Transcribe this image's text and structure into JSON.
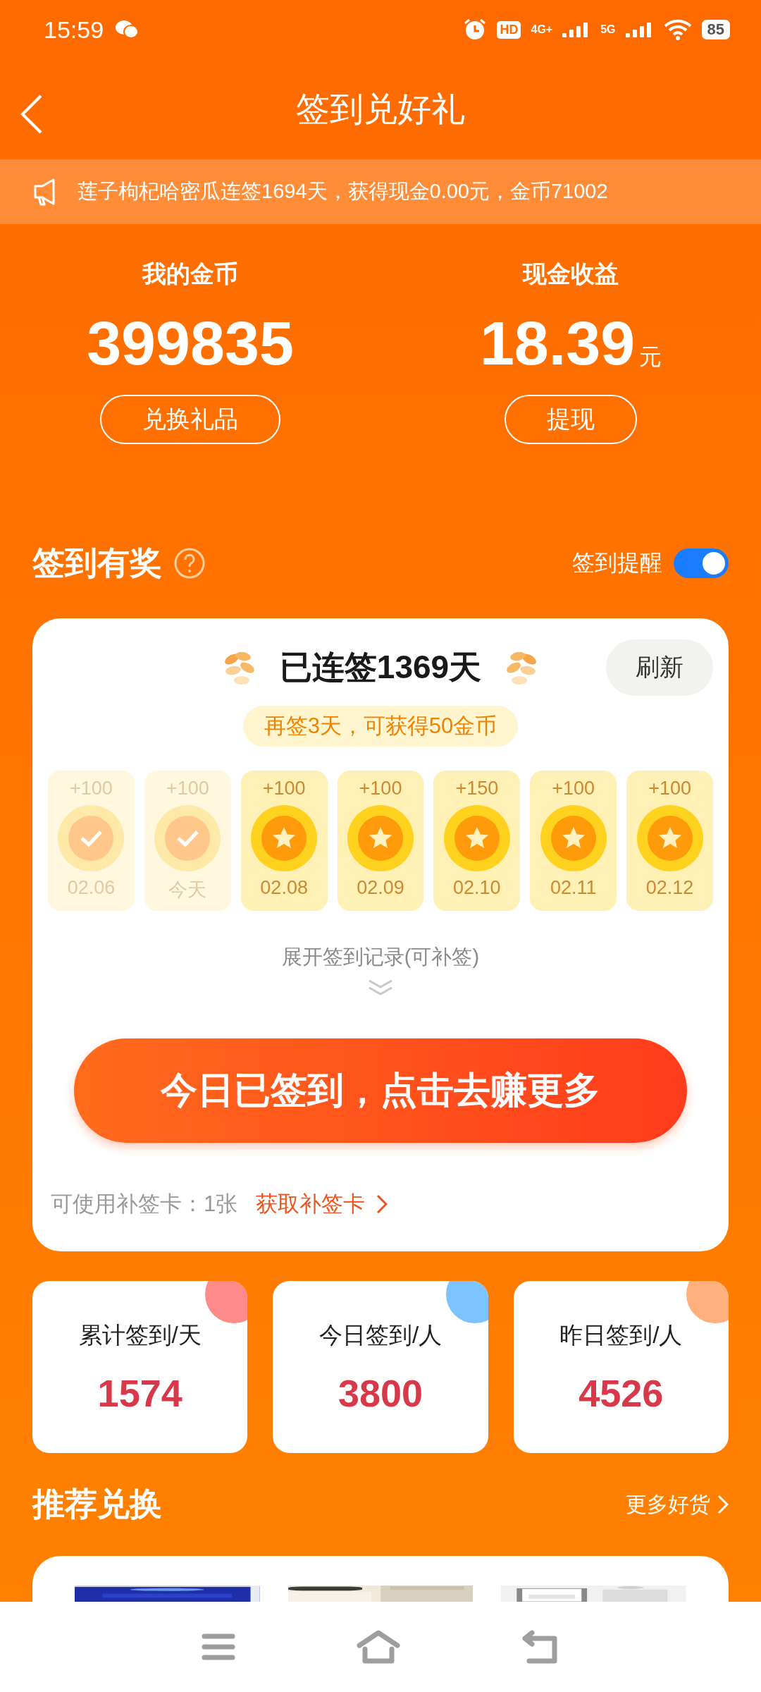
{
  "status_bar": {
    "time": "15:59",
    "hd": "HD",
    "networks": [
      "4G+",
      "5G"
    ],
    "battery": "85"
  },
  "header": {
    "title": "签到兑好礼"
  },
  "announcement": "莲子枸杞哈密瓜连签1694天，获得现金0.00元，金币71002",
  "balances": [
    {
      "label": "我的金币",
      "value": "399835",
      "button": "兑换礼品"
    },
    {
      "label": "现金收益",
      "value": "18.39",
      "unit": "元",
      "button": "提现"
    }
  ],
  "checkin": {
    "title": "签到有奖",
    "reminder": {
      "label": "签到提醒",
      "on": true
    },
    "streak": "已连签1369天",
    "refresh": "刷新",
    "bonus": "再签3天，可获得50金币",
    "days": [
      {
        "reward": "+100",
        "date": "02.06",
        "checked": true
      },
      {
        "reward": "+100",
        "date": "今天",
        "checked": true
      },
      {
        "reward": "+100",
        "date": "02.08",
        "checked": false
      },
      {
        "reward": "+100",
        "date": "02.09",
        "checked": false
      },
      {
        "reward": "+150",
        "date": "02.10",
        "checked": false
      },
      {
        "reward": "+100",
        "date": "02.11",
        "checked": false
      },
      {
        "reward": "+100",
        "date": "02.12",
        "checked": false
      }
    ],
    "expand": "展开签到记录(可补签)",
    "cta": "今日已签到，点击去赚更多",
    "makeup_cards": "可使用补签卡：1张",
    "get_card": "获取补签卡"
  },
  "stats": [
    {
      "label": "累计签到/天",
      "value": "1574",
      "color": "#ff8a8a"
    },
    {
      "label": "今日签到/人",
      "value": "3800",
      "color": "#7cc4ff"
    },
    {
      "label": "昨日签到/人",
      "value": "4526",
      "color": "#ffb07c"
    }
  ],
  "recommend": {
    "title": "推荐兑换",
    "more": "更多好货"
  }
}
